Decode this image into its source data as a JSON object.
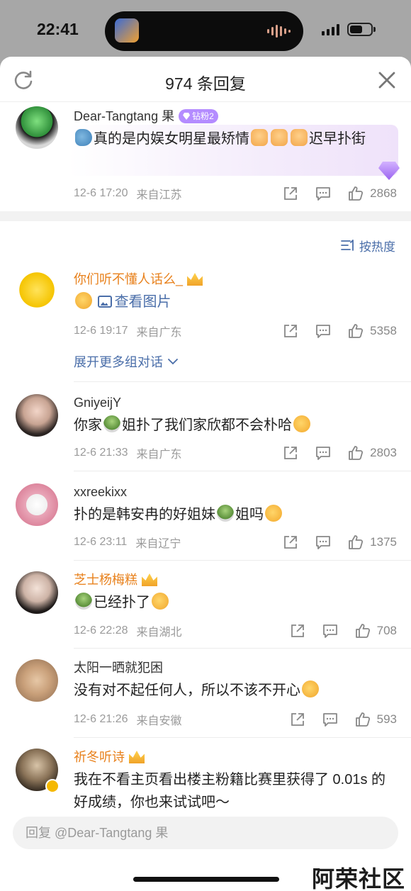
{
  "status_bar": {
    "time": "22:41"
  },
  "sheet": {
    "title": "974 条回复"
  },
  "top_comment": {
    "name": "Dear-Tangtang 果",
    "badge": "钻粉2",
    "text_a": "真的是内娱女明星最矫情",
    "text_b": "迟早扑街",
    "date": "12-6 17:20",
    "location": "来自江苏",
    "likes": "2868"
  },
  "sort_label": "按热度",
  "comments": [
    {
      "name": "你们听不懂人话么_",
      "text": "查看图片",
      "date": "12-6 19:17",
      "location": "来自广东",
      "likes": "5358"
    },
    {
      "name": "GniyeijY",
      "text_a": "你家",
      "text_b": "姐扑了我们家欣都不会朴哈",
      "date": "12-6 21:33",
      "location": "来自广东",
      "likes": "2803"
    },
    {
      "name": "xxreekixx",
      "text_a": "扑的是韩安冉的好姐妹",
      "text_b": "姐吗",
      "date": "12-6 23:11",
      "location": "来自辽宁",
      "likes": "1375"
    },
    {
      "name": "芝士杨梅糕",
      "text": "已经扑了",
      "date": "12-6 22:28",
      "location": "来自湖北",
      "likes": "708"
    },
    {
      "name": "太阳一晒就犯困",
      "text": "没有对不起任何人，所以不该不开心",
      "date": "12-6 21:26",
      "location": "来自安徽",
      "likes": "593"
    },
    {
      "name": "祈冬听诗",
      "text": "我在不看主页看出楼主粉籍比赛里获得了 0.01s 的好成绩，你也来试试吧～"
    }
  ],
  "expand_label": "展开更多组对话",
  "reply": {
    "placeholder": "回复 @Dear-Tangtang 果"
  },
  "watermark": "阿荣社区",
  "colors": {
    "link": "#4a6ea9",
    "vip_name": "#e8811c",
    "badge": "#b48cff",
    "meta": "#9a9a9a"
  }
}
